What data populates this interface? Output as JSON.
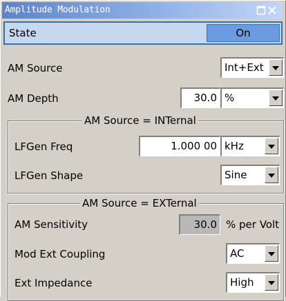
{
  "window": {
    "title": "Amplitude Modulation"
  },
  "state": {
    "label": "State",
    "value": "On"
  },
  "am_source": {
    "label": "AM Source",
    "value": "Int+Ext"
  },
  "am_depth": {
    "label": "AM Depth",
    "value": "30.0",
    "unit": "%"
  },
  "internal": {
    "title": "AM Source = INTernal",
    "freq_label": "LFGen Freq",
    "freq_value": "1.000 00",
    "freq_unit": "kHz",
    "shape_label": "LFGen Shape",
    "shape_value": "Sine"
  },
  "external": {
    "title": "AM Source = EXTernal",
    "sens_label": "AM Sensitivity",
    "sens_value": "30.0",
    "sens_unit": "% per Volt",
    "coupling_label": "Mod Ext Coupling",
    "coupling_value": "AC",
    "impedance_label": "Ext Impedance",
    "impedance_value": "High"
  }
}
